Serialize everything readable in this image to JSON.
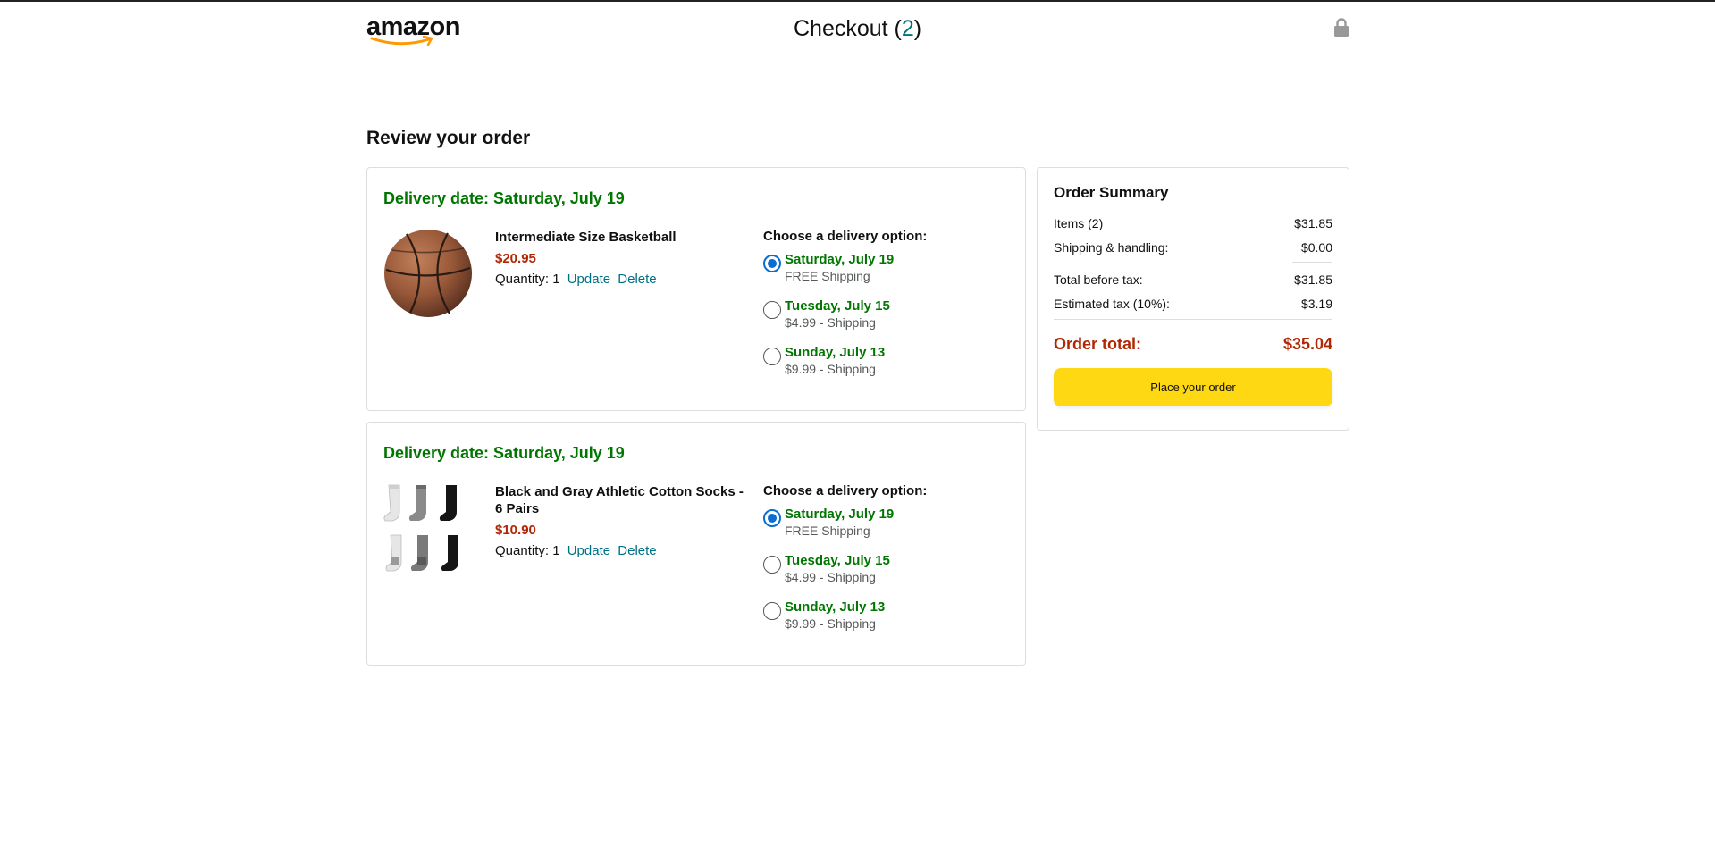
{
  "header": {
    "logo_text": "amazon",
    "checkout_label": "Checkout (",
    "checkout_count": "2",
    "checkout_close": ")"
  },
  "page_title": "Review your order",
  "shipments": [
    {
      "delivery_date": "Delivery date: Saturday, July 19",
      "product_name": "Intermediate Size Basketball",
      "price": "$20.95",
      "quantity_label": "Quantity: 1",
      "update_label": "Update",
      "delete_label": "Delete",
      "options_title": "Choose a delivery option:",
      "options": [
        {
          "date": "Saturday, July 19",
          "price": "FREE Shipping",
          "selected": true
        },
        {
          "date": "Tuesday, July 15",
          "price": "$4.99 - Shipping",
          "selected": false
        },
        {
          "date": "Sunday, July 13",
          "price": "$9.99 - Shipping",
          "selected": false
        }
      ]
    },
    {
      "delivery_date": "Delivery date: Saturday, July 19",
      "product_name": "Black and Gray Athletic Cotton Socks - 6 Pairs",
      "price": "$10.90",
      "quantity_label": "Quantity: 1",
      "update_label": "Update",
      "delete_label": "Delete",
      "options_title": "Choose a delivery option:",
      "options": [
        {
          "date": "Saturday, July 19",
          "price": "FREE Shipping",
          "selected": true
        },
        {
          "date": "Tuesday, July 15",
          "price": "$4.99 - Shipping",
          "selected": false
        },
        {
          "date": "Sunday, July 13",
          "price": "$9.99 - Shipping",
          "selected": false
        }
      ]
    }
  ],
  "summary": {
    "title": "Order Summary",
    "items_label": "Items (2)",
    "items_value": "$31.85",
    "shipping_label": "Shipping & handling:",
    "shipping_value": "$0.00",
    "before_tax_label": "Total before tax:",
    "before_tax_value": "$31.85",
    "tax_label": "Estimated tax (10%):",
    "tax_value": "$3.19",
    "total_label": "Order total:",
    "total_value": "$35.04",
    "place_order_label": "Place your order"
  },
  "colors": {
    "green": "#007600",
    "price_red": "#b12704",
    "link": "#007185",
    "button": "#ffd814",
    "radio": "#0a6ed1"
  },
  "icons": {
    "logo": "amazon-logo",
    "lock": "lock-icon",
    "basketball": "basketball-image",
    "socks": "socks-image"
  }
}
